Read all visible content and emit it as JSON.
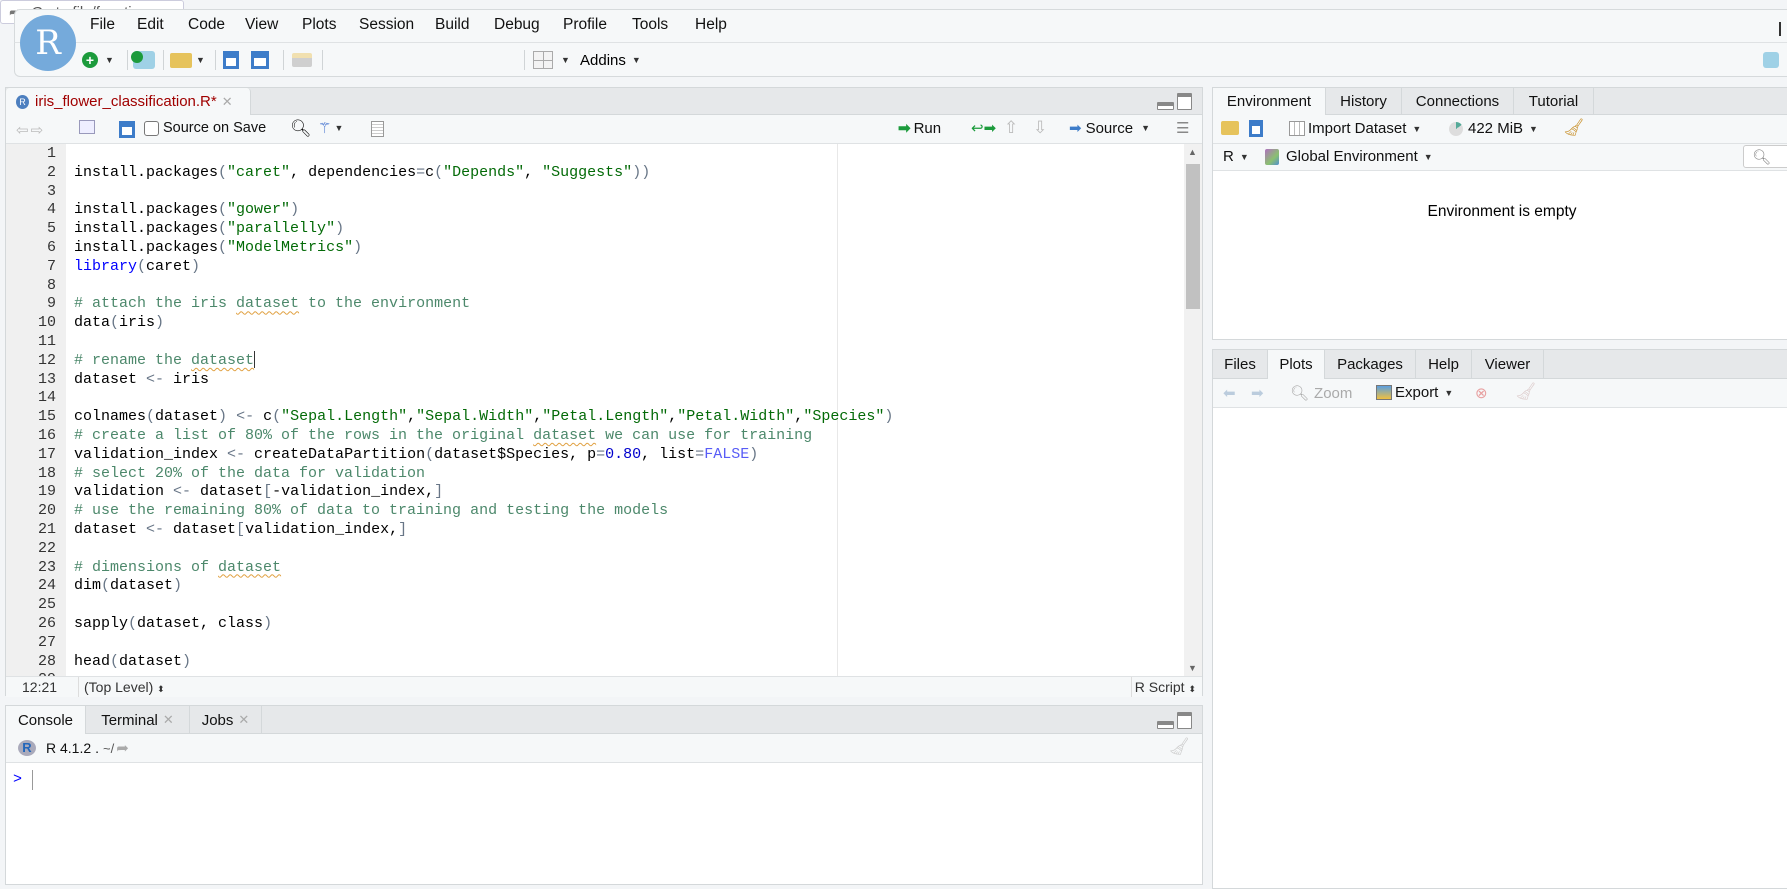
{
  "app": {
    "logo": "R"
  },
  "menu": [
    "File",
    "Edit",
    "Code",
    "View",
    "Plots",
    "Session",
    "Build",
    "Debug",
    "Profile",
    "Tools",
    "Help"
  ],
  "toolbar": {
    "goto_placeholder": "Go to file/function",
    "addins": "Addins"
  },
  "editor": {
    "tab": {
      "label": "iris_flower_classification.R*",
      "modified": true
    },
    "source_on_save": "Source on Save",
    "source_on_save_checked": false,
    "run": "Run",
    "source": "Source",
    "cursor": "12:21",
    "scope": "(Top Level)",
    "filetype": "R Script",
    "lines": [
      [],
      [
        [
          "pl",
          "install.packages"
        ],
        [
          "op",
          "("
        ],
        [
          "str",
          "\"caret\""
        ],
        [
          "pl",
          ", dependencies"
        ],
        [
          "op",
          "="
        ],
        [
          "pl",
          "c"
        ],
        [
          "op",
          "("
        ],
        [
          "str",
          "\"Depends\""
        ],
        [
          "pl",
          ", "
        ],
        [
          "str",
          "\"Suggests\""
        ],
        [
          "op",
          "))"
        ]
      ],
      [],
      [
        [
          "pl",
          "install.packages"
        ],
        [
          "op",
          "("
        ],
        [
          "str",
          "\"gower\""
        ],
        [
          "op",
          ")"
        ]
      ],
      [
        [
          "pl",
          "install.packages"
        ],
        [
          "op",
          "("
        ],
        [
          "str",
          "\"parallelly\""
        ],
        [
          "op",
          ")"
        ]
      ],
      [
        [
          "pl",
          "install.packages"
        ],
        [
          "op",
          "("
        ],
        [
          "str",
          "\"ModelMetrics\""
        ],
        [
          "op",
          ")"
        ]
      ],
      [
        [
          "kw",
          "library"
        ],
        [
          "op",
          "("
        ],
        [
          "pl",
          "caret"
        ],
        [
          "op",
          ")"
        ]
      ],
      [],
      [
        [
          "cm",
          "# attach the iris "
        ],
        [
          "spell",
          "dataset"
        ],
        [
          "cm",
          " to the environment"
        ]
      ],
      [
        [
          "pl",
          "data"
        ],
        [
          "op",
          "("
        ],
        [
          "pl",
          "iris"
        ],
        [
          "op",
          ")"
        ]
      ],
      [],
      [
        [
          "cm",
          "# rename the "
        ],
        [
          "spell",
          "dataset"
        ]
      ],
      [
        [
          "pl",
          "dataset "
        ],
        [
          "op",
          "<-"
        ],
        [
          "pl",
          " iris"
        ]
      ],
      [],
      [
        [
          "pl",
          "colnames"
        ],
        [
          "op",
          "("
        ],
        [
          "pl",
          "dataset"
        ],
        [
          "op",
          ")"
        ],
        [
          "pl",
          " "
        ],
        [
          "op",
          "<-"
        ],
        [
          "pl",
          " c"
        ],
        [
          "op",
          "("
        ],
        [
          "str",
          "\"Sepal.Length\""
        ],
        [
          "pl",
          ","
        ],
        [
          "str",
          "\"Sepal.Width\""
        ],
        [
          "pl",
          ","
        ],
        [
          "str",
          "\"Petal.Length\""
        ],
        [
          "pl",
          ","
        ],
        [
          "str",
          "\"Petal.Width\""
        ],
        [
          "pl",
          ","
        ],
        [
          "str",
          "\"Species\""
        ],
        [
          "op",
          ")"
        ]
      ],
      [
        [
          "cm",
          "# create a list of 80% of the rows in the original "
        ],
        [
          "spell",
          "dataset"
        ],
        [
          "cm",
          " we can use for training"
        ]
      ],
      [
        [
          "pl",
          "validation_index "
        ],
        [
          "op",
          "<-"
        ],
        [
          "pl",
          " createDataPartition"
        ],
        [
          "op",
          "("
        ],
        [
          "pl",
          "dataset$Species, p"
        ],
        [
          "op",
          "="
        ],
        [
          "num",
          "0.80"
        ],
        [
          "pl",
          ", list"
        ],
        [
          "op",
          "="
        ],
        [
          "const",
          "FALSE"
        ],
        [
          "op",
          ")"
        ]
      ],
      [
        [
          "cm",
          "# select 20% of the data for validation"
        ]
      ],
      [
        [
          "pl",
          "validation "
        ],
        [
          "op",
          "<-"
        ],
        [
          "pl",
          " dataset"
        ],
        [
          "op",
          "["
        ],
        [
          "pl",
          "-validation_index,"
        ],
        [
          "op",
          "]"
        ]
      ],
      [
        [
          "cm",
          "# use the remaining 80% of data to training and testing the models"
        ]
      ],
      [
        [
          "pl",
          "dataset "
        ],
        [
          "op",
          "<-"
        ],
        [
          "pl",
          " dataset"
        ],
        [
          "op",
          "["
        ],
        [
          "pl",
          "validation_index,"
        ],
        [
          "op",
          "]"
        ]
      ],
      [],
      [
        [
          "cm",
          "# dimensions of "
        ],
        [
          "spell",
          "dataset"
        ]
      ],
      [
        [
          "pl",
          "dim"
        ],
        [
          "op",
          "("
        ],
        [
          "pl",
          "dataset"
        ],
        [
          "op",
          ")"
        ]
      ],
      [],
      [
        [
          "pl",
          "sapply"
        ],
        [
          "op",
          "("
        ],
        [
          "pl",
          "dataset, class"
        ],
        [
          "op",
          ")"
        ]
      ],
      [],
      [
        [
          "pl",
          "head"
        ],
        [
          "op",
          "("
        ],
        [
          "pl",
          "dataset"
        ],
        [
          "op",
          ")"
        ]
      ],
      []
    ]
  },
  "console": {
    "tabs": [
      "Console",
      "Terminal",
      "Jobs"
    ],
    "version": "R 4.1.2",
    "path": "~/",
    "prompt": ">"
  },
  "environment": {
    "tabs": [
      "Environment",
      "History",
      "Connections",
      "Tutorial"
    ],
    "import_dataset": "Import Dataset",
    "memory": "422 MiB",
    "language": "R",
    "scope": "Global Environment",
    "empty_message": "Environment is empty"
  },
  "files": {
    "tabs": [
      "Files",
      "Plots",
      "Packages",
      "Help",
      "Viewer"
    ],
    "active": "Plots",
    "zoom": "Zoom",
    "export": "Export"
  },
  "colors": {
    "logo": "#75aadb",
    "string": "#036a07",
    "keyword": "#0000ff",
    "comment": "#4c886b",
    "tab_title": "#a00000"
  }
}
